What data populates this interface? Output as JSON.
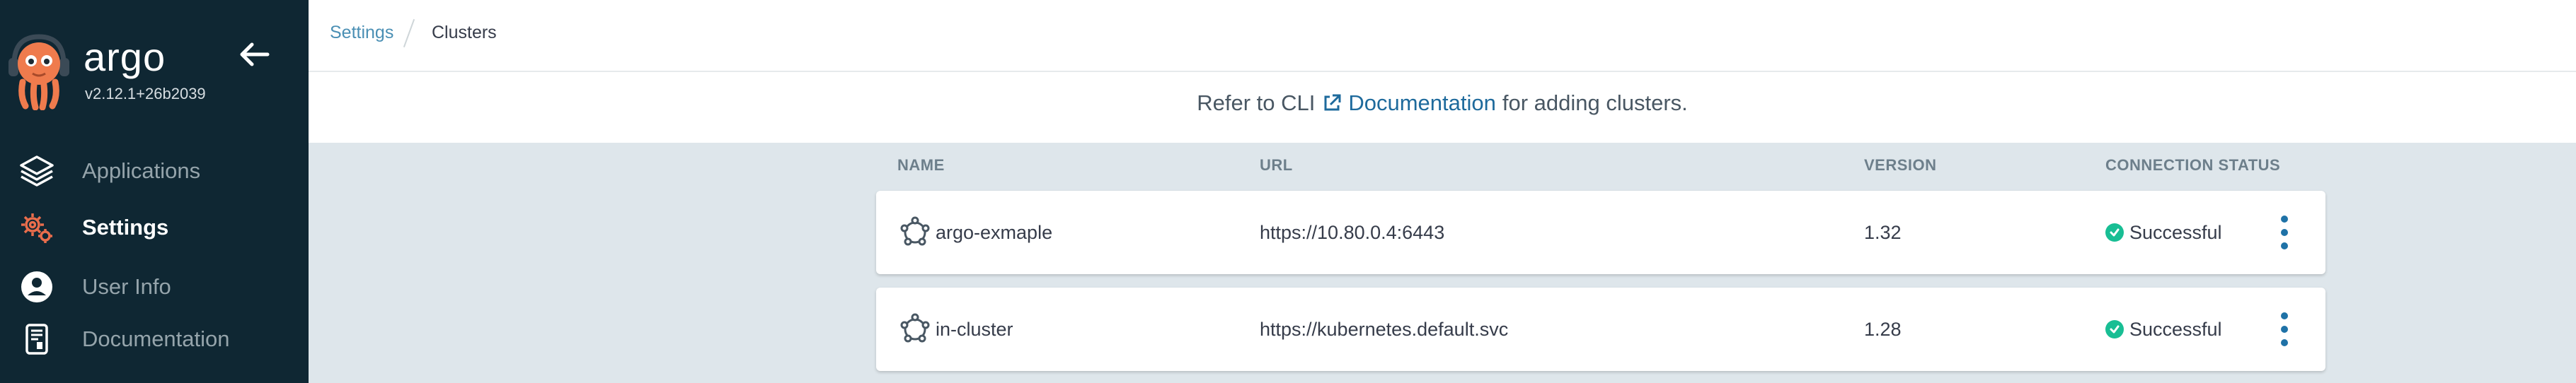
{
  "sidebar": {
    "brand": "argo",
    "version": "v2.12.1+26b2039",
    "items": [
      {
        "label": "Applications",
        "icon": "stack-icon",
        "active": false
      },
      {
        "label": "Settings",
        "icon": "gear-icon",
        "active": true
      },
      {
        "label": "User Info",
        "icon": "user-icon",
        "active": false
      },
      {
        "label": "Documentation",
        "icon": "book-icon",
        "active": false
      }
    ]
  },
  "breadcrumb": {
    "parent": "Settings",
    "current": "Clusters"
  },
  "info": {
    "prefix": "Refer to CLI",
    "link": "Documentation",
    "suffix": "for adding clusters."
  },
  "table": {
    "headers": [
      "NAME",
      "URL",
      "VERSION",
      "CONNECTION STATUS"
    ],
    "rows": [
      {
        "name": "argo-exmaple",
        "url": "https://10.80.0.4:6443",
        "version": "1.32",
        "status": "Successful"
      },
      {
        "name": "in-cluster",
        "url": "https://kubernetes.default.svc",
        "version": "1.28",
        "status": "Successful"
      }
    ]
  },
  "colors": {
    "sidebar_bg": "#0f2733",
    "accent": "#1f72a7",
    "success": "#18be94",
    "settings_icon": "#e96d4c"
  }
}
